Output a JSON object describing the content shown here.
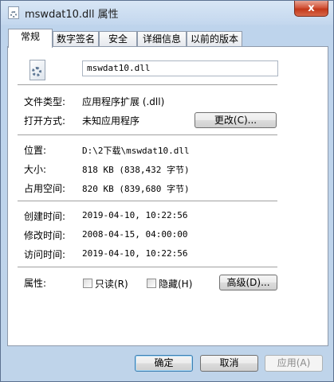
{
  "window": {
    "title": "mswdat10.dll 属性",
    "close_label": "x"
  },
  "tabs": [
    {
      "label": "常规",
      "active": true
    },
    {
      "label": "数字签名",
      "active": false
    },
    {
      "label": "安全",
      "active": false
    },
    {
      "label": "详细信息",
      "active": false
    },
    {
      "label": "以前的版本",
      "active": false
    }
  ],
  "general": {
    "file_name": "mswdat10.dll",
    "file_type_label": "文件类型:",
    "file_type_value": "应用程序扩展 (.dll)",
    "open_with_label": "打开方式:",
    "open_with_value": "未知应用程序",
    "change_button": "更改(C)...",
    "location_label": "位置:",
    "location_value": "D:\\2下载\\mswdat10.dll",
    "size_label": "大小:",
    "size_value": "818 KB (838,432 字节)",
    "size_on_disk_label": "占用空间:",
    "size_on_disk_value": "820 KB (839,680 字节)",
    "created_label": "创建时间:",
    "created_value": "2019-04-10, 10:22:56",
    "modified_label": "修改时间:",
    "modified_value": "2008-04-15, 04:00:00",
    "accessed_label": "访问时间:",
    "accessed_value": "2019-04-10, 10:22:56",
    "attributes_label": "属性:",
    "readonly_label": "只读(R)",
    "readonly_checked": false,
    "hidden_label": "隐藏(H)",
    "hidden_checked": false,
    "advanced_button": "高级(D)..."
  },
  "footer": {
    "ok": "确定",
    "cancel": "取消",
    "apply": "应用(A)"
  }
}
